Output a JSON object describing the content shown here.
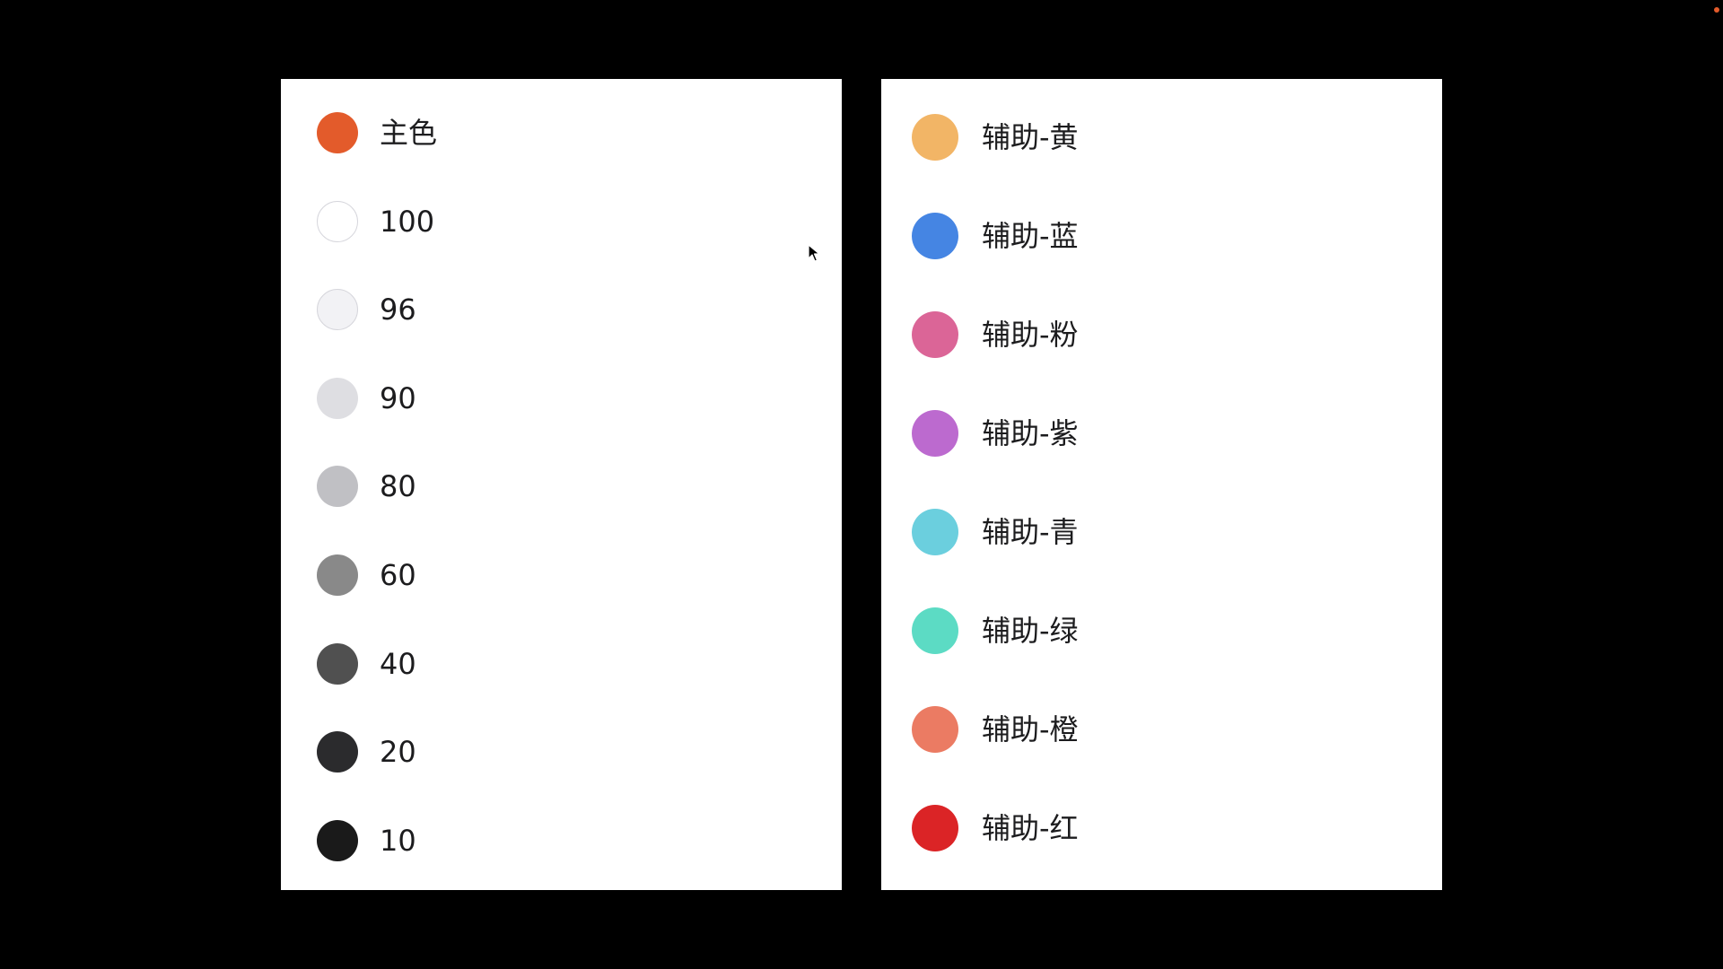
{
  "left_panel": {
    "items": [
      {
        "label": "主色",
        "color": "#E35B2B",
        "outlined": false
      },
      {
        "label": "100",
        "color": "#FFFFFF",
        "outlined": true
      },
      {
        "label": "96",
        "color": "#F2F2F5",
        "outlined": true
      },
      {
        "label": "90",
        "color": "#DEDEE2",
        "outlined": false
      },
      {
        "label": "80",
        "color": "#C0C0C4",
        "outlined": false
      },
      {
        "label": "60",
        "color": "#898989",
        "outlined": false
      },
      {
        "label": "40",
        "color": "#505050",
        "outlined": false
      },
      {
        "label": "20",
        "color": "#2B2B2D",
        "outlined": false
      },
      {
        "label": "10",
        "color": "#1A1A1A",
        "outlined": false
      }
    ]
  },
  "right_panel": {
    "items": [
      {
        "label": "辅助-黄",
        "color": "#F2B566"
      },
      {
        "label": "辅助-蓝",
        "color": "#4585E3"
      },
      {
        "label": "辅助-粉",
        "color": "#DB6597"
      },
      {
        "label": "辅助-紫",
        "color": "#BC6ACF"
      },
      {
        "label": "辅助-青",
        "color": "#6BCFDE"
      },
      {
        "label": "辅助-绿",
        "color": "#5CDBC4"
      },
      {
        "label": "辅助-橙",
        "color": "#EB7B63"
      },
      {
        "label": "辅助-红",
        "color": "#DB2426"
      }
    ]
  },
  "corner_indicator": {
    "color": "#E35B2B"
  },
  "cursor": {
    "icon": "arrow-pointer-icon"
  }
}
